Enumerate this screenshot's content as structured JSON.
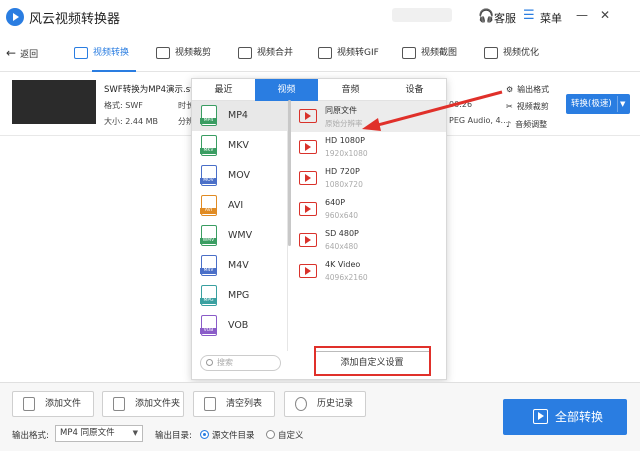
{
  "app": {
    "title": "风云视频转换器"
  },
  "titlebar": {
    "service": "客服",
    "menu": "菜单",
    "minimize": "—",
    "close": "✕"
  },
  "nav": {
    "back": "返回",
    "items": [
      {
        "label": "视频转换"
      },
      {
        "label": "视频裁剪"
      },
      {
        "label": "视频合并"
      },
      {
        "label": "视频转GIF"
      },
      {
        "label": "视频截图"
      },
      {
        "label": "视频优化"
      }
    ]
  },
  "file": {
    "name": "SWF转换为MP4演示.sw",
    "format_label": "格式: SWF",
    "size_label": "大小: 2.44 MB",
    "dur_partial": "时长",
    "res_partial": "分辨",
    "time_right": "00:26",
    "codec_right": "PEG Audio, 4..."
  },
  "side": {
    "out_format": "输出格式",
    "video_crop": "视频裁剪",
    "audio_adjust": "音频调整"
  },
  "convert_button": {
    "label": "转换(极速)",
    "arrow": "▼"
  },
  "popup": {
    "tabs": [
      "最近",
      "视频",
      "音频",
      "设备"
    ],
    "active_tab": 1,
    "formats": [
      {
        "name": "MP4",
        "color": "#3a9d62"
      },
      {
        "name": "MKV",
        "color": "#3a9d62"
      },
      {
        "name": "MOV",
        "color": "#4a6fc8"
      },
      {
        "name": "AVI",
        "color": "#e08b23"
      },
      {
        "name": "WMV",
        "color": "#3a9d62"
      },
      {
        "name": "M4V",
        "color": "#4a6fc8"
      },
      {
        "name": "MPG",
        "color": "#3aa0a0"
      },
      {
        "name": "VOB",
        "color": "#8a5cc8"
      }
    ],
    "resolutions": [
      {
        "name": "同原文件",
        "sub": "原始分辨率"
      },
      {
        "name": "HD 1080P",
        "sub": "1920x1080"
      },
      {
        "name": "HD 720P",
        "sub": "1080x720"
      },
      {
        "name": "640P",
        "sub": "960x640"
      },
      {
        "name": "SD 480P",
        "sub": "640x480"
      },
      {
        "name": "4K Video",
        "sub": "4096x2160"
      }
    ],
    "search_placeholder": "搜索",
    "custom_button": "添加自定义设置"
  },
  "bottom": {
    "add_file": "添加文件",
    "add_folder": "添加文件夹",
    "clear_list": "清空列表",
    "history": "历史记录",
    "output_format_label": "输出格式:",
    "output_format_value": "MP4 同原文件",
    "output_dir_label": "输出目录:",
    "dir_source": "源文件目录",
    "dir_custom": "自定义",
    "convert_all": "全部转换"
  },
  "colors": {
    "accent": "#2a7de1",
    "annotation_red": "#e0302a"
  }
}
